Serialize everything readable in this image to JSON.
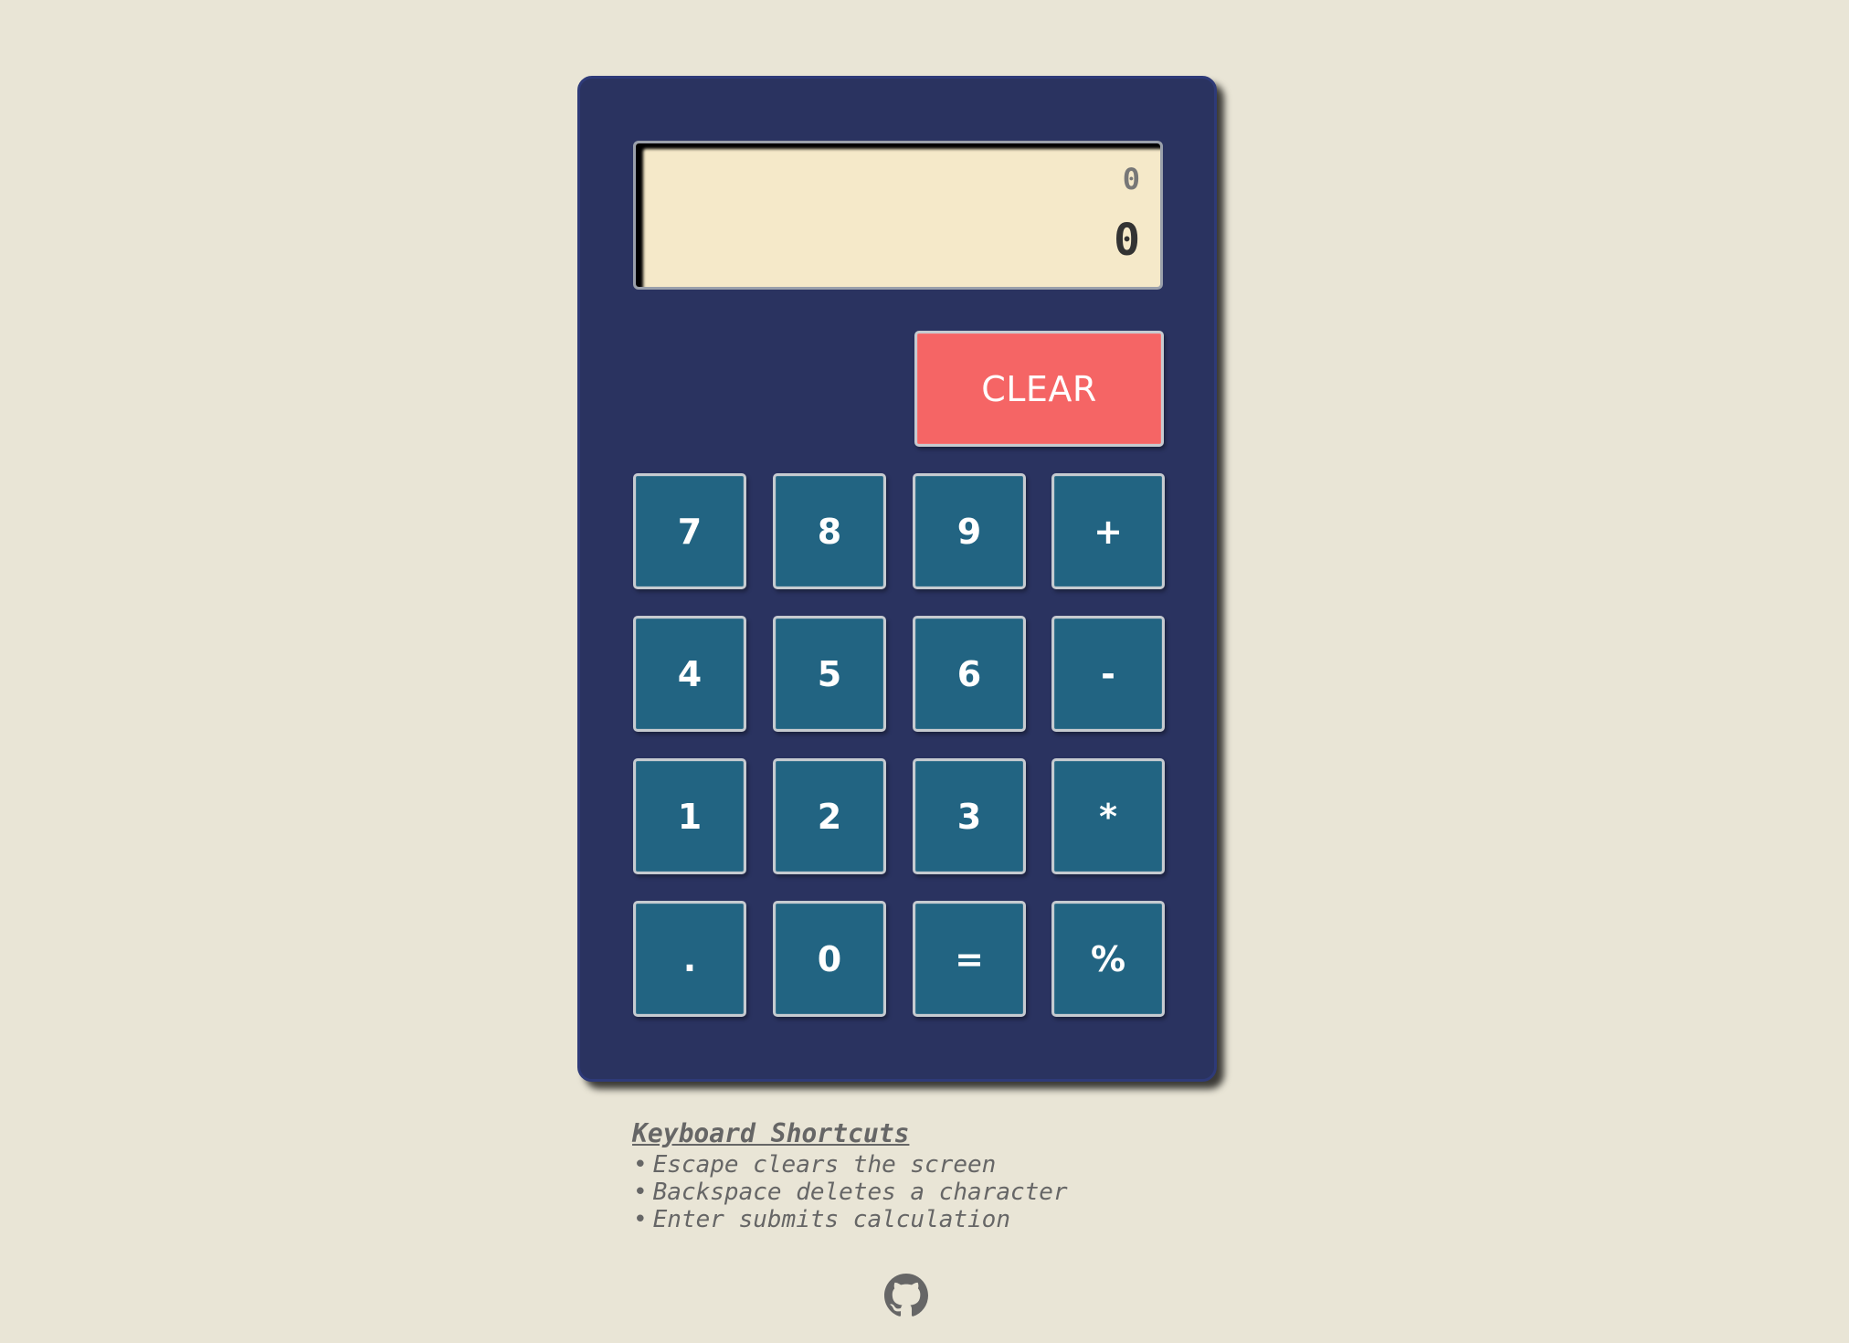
{
  "display": {
    "previous": "0",
    "current": "0"
  },
  "keys": {
    "clear": "CLEAR",
    "rows": [
      [
        "7",
        "8",
        "9",
        "+"
      ],
      [
        "4",
        "5",
        "6",
        "-"
      ],
      [
        "1",
        "2",
        "3",
        "*"
      ],
      [
        ".",
        "0",
        "=",
        "%"
      ]
    ]
  },
  "shortcuts": {
    "title": "Keyboard Shortcuts",
    "items": [
      "Escape clears the screen",
      "Backspace deletes a character",
      "Enter submits calculation"
    ]
  },
  "footer": {
    "icon": "github-icon"
  },
  "colors": {
    "background": "#e9e5d6",
    "body": "#2a3360",
    "screen": "#f5e9c9",
    "key": "#226482",
    "clear": "#f56565"
  }
}
